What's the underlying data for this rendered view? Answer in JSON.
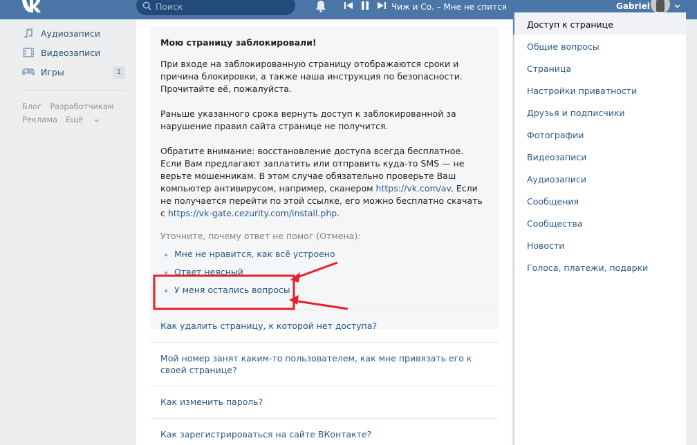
{
  "header": {
    "search_placeholder": "Поиск",
    "track": "Чиж и Со. – Мне не спится",
    "user_name": "Gabriel"
  },
  "left_nav": {
    "items": [
      {
        "label": "Аудиозаписи",
        "icon": "music-icon"
      },
      {
        "label": "Видеозаписи",
        "icon": "film-icon"
      },
      {
        "label": "Игры",
        "icon": "gamepad-icon",
        "count": "1"
      }
    ],
    "footer": {
      "blog": "Блог",
      "developers": "Разработчикам",
      "ads": "Реклама",
      "more": "Ещё"
    }
  },
  "faq": {
    "title": "Мою страницу заблокировали!",
    "paragraph1": "При входе на заблокированную страницу отображаются сроки и причина блокировки, а также наша инструкция по безопасности. Прочитайте её, пожалуйста.",
    "paragraph2": "Раньше указанного срока вернуть доступ к заблокированной за нарушение правил сайта странице не получится.",
    "paragraph3_line1": "Обратите внимание: восстановление доступа всегда бесплатное.",
    "paragraph3_line2": "Если Вам предлагают заплатить или отправить куда-то SMS — не верьте мошенникам. В этом случае обязательно проверьте Ваш компьютер антивирусом, например, сканером",
    "link1": "https://vk.com/av",
    "paragraph3_line3": ". Если не получается перейти по этой ссылке, его можно бесплатно скачать с",
    "link2": "https://vk-gate.cezurity.com/install.php",
    "paragraph3_end": ".",
    "ask_prefix": "Уточните, почему ответ не помог (",
    "ask_cancel": "Отмена",
    "ask_suffix": "):",
    "options": [
      "Мне не нравится, как всё устроено",
      "Ответ неясный",
      "У меня остались вопросы"
    ]
  },
  "questions": [
    "Как удалить страницу, к которой нет доступа?",
    "Мой номер занят каким-то пользователем, как мне привязать его к своей странице?",
    "Как изменить пароль?",
    "Как зарегистрироваться на сайте ВКонтакте?"
  ],
  "right_nav": {
    "items": [
      "Доступ к странице",
      "Общие вопросы",
      "Страница",
      "Настройки приватности",
      "Друзья и подписчики",
      "Фотографии",
      "Видеозаписи",
      "Аудиозаписи",
      "Сообщения",
      "Сообщества",
      "Новости",
      "Голоса, платежи, подарки"
    ],
    "active_index": 0
  },
  "colors": {
    "header_bg": "#4a76a8",
    "link": "#2a5885",
    "annotation_red": "#e8202a"
  }
}
